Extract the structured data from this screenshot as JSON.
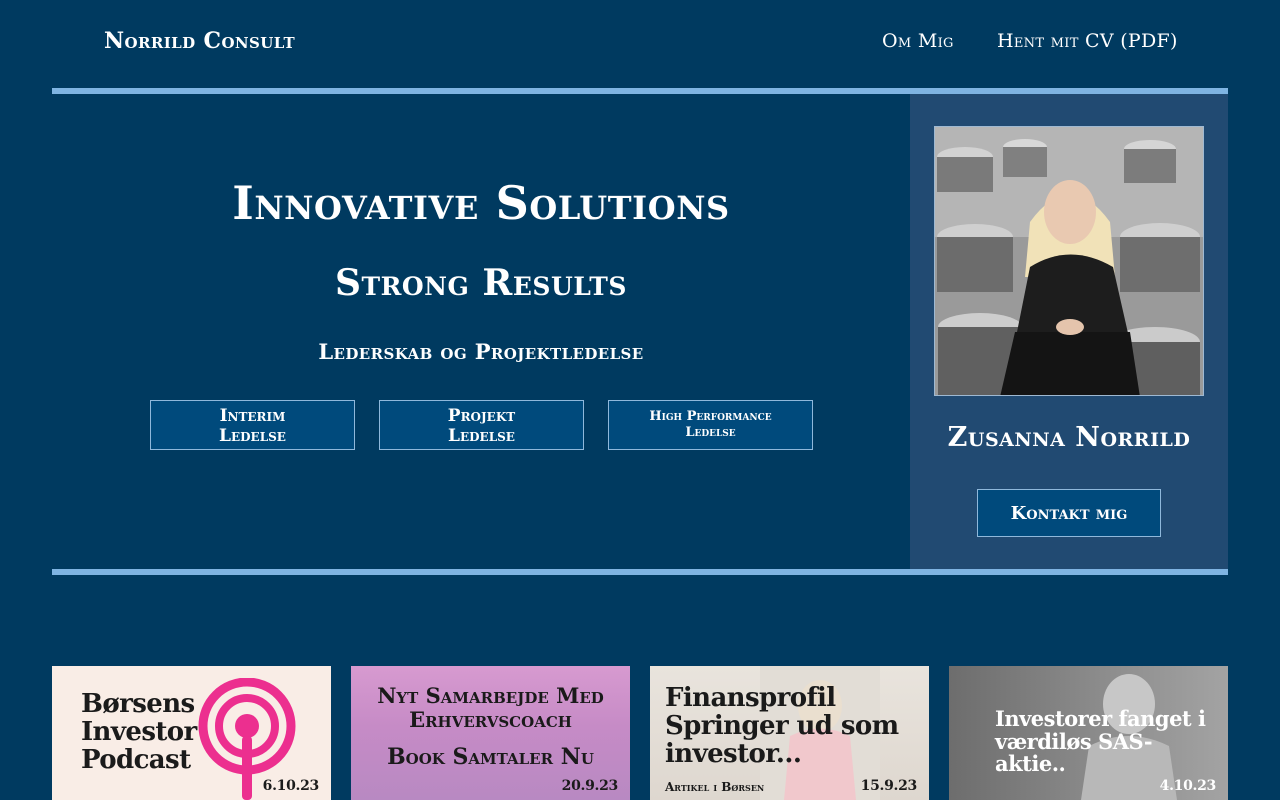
{
  "header": {
    "brand": "Norrild Consult",
    "nav": {
      "about": "Om Mig",
      "cv": "Hent mit CV (PDF)"
    }
  },
  "hero": {
    "title": "Innovative Solutions",
    "subtitle": "Strong Results",
    "tagline": "Lederskab og Projektledelse",
    "services": [
      {
        "label": "Interim Ledelse"
      },
      {
        "label": "Projekt Ledelse"
      },
      {
        "label": "High Performance Ledelse"
      }
    ]
  },
  "profile": {
    "name": "Zusanna Norrild",
    "contact_label": "Kontakt mig"
  },
  "cards": [
    {
      "title": "Børsens Investor Podcast",
      "date": "6.10.23"
    },
    {
      "title": "Nyt Samarbejde Med Erhvervscoach",
      "subtitle": "Book Samtaler Nu",
      "date": "20.9.23"
    },
    {
      "title": "Finansprofil Springer ud som investor...",
      "meta": "Artikel i Børsen",
      "date": "15.9.23"
    },
    {
      "title": "Investorer fanget i værdiløs SAS-aktie..",
      "date": "4.10.23"
    }
  ],
  "colors": {
    "background": "#003a60",
    "panel": "#214a72",
    "accent_rule": "#7fb4e2",
    "button": "#004a7c",
    "podcast_pink": "#ec2f8f"
  }
}
